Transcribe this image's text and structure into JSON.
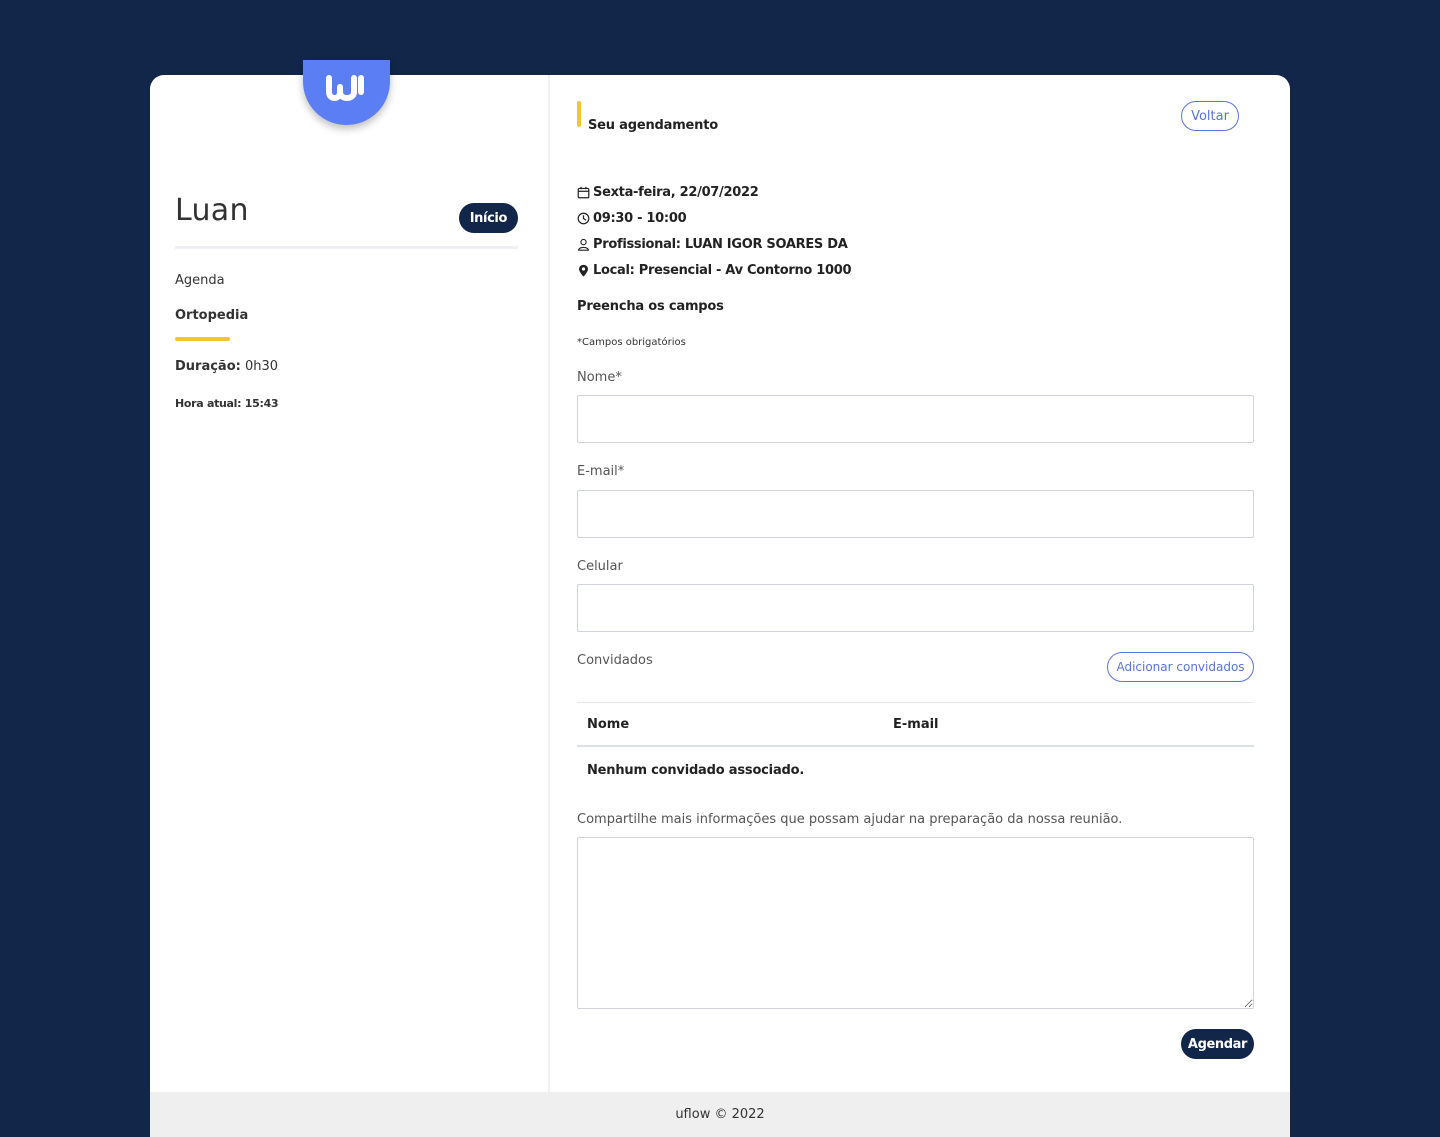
{
  "brand": {
    "logo": "uflow-logo",
    "accent": "#5c7ef5",
    "navy": "#12264a",
    "yellow": "#f5c430"
  },
  "sidebar": {
    "user_name": "Luan",
    "home_button": "Início",
    "agenda_label": "Agenda",
    "service": "Ortopedia",
    "duration_label": "Duração:",
    "duration_value": "0h30",
    "current_time": "Hora atual: 15:43"
  },
  "header": {
    "title": "Seu agendamento",
    "back_button": "Voltar"
  },
  "appointment": {
    "date": "Sexta-feira, 22/07/2022",
    "time": "09:30 - 10:00",
    "professional": "Profissional: LUAN IGOR SOARES DA",
    "location": "Local: Presencial - Av Contorno 1000"
  },
  "form": {
    "title": "Preencha os campos",
    "required_note": "*Campos obrigatórios",
    "name_label": "Nome*",
    "name_value": "",
    "email_label": "E-mail*",
    "email_value": "",
    "phone_label": "Celular",
    "phone_value": "",
    "guests_label": "Convidados",
    "add_guests_button": "Adicionar convidados",
    "guests_table": {
      "columns": [
        "Nome",
        "E-mail"
      ],
      "empty_message": "Nenhum convidado associado."
    },
    "notes_label": "Compartilhe mais informações que possam ajudar na preparação da nossa reunião.",
    "notes_value": "",
    "submit_button": "Agendar"
  },
  "footer": {
    "text": "uflow © 2022"
  },
  "icons": {
    "date": "calendar-icon",
    "time": "clock-icon",
    "professional": "user-icon",
    "location": "map-pin-icon"
  }
}
